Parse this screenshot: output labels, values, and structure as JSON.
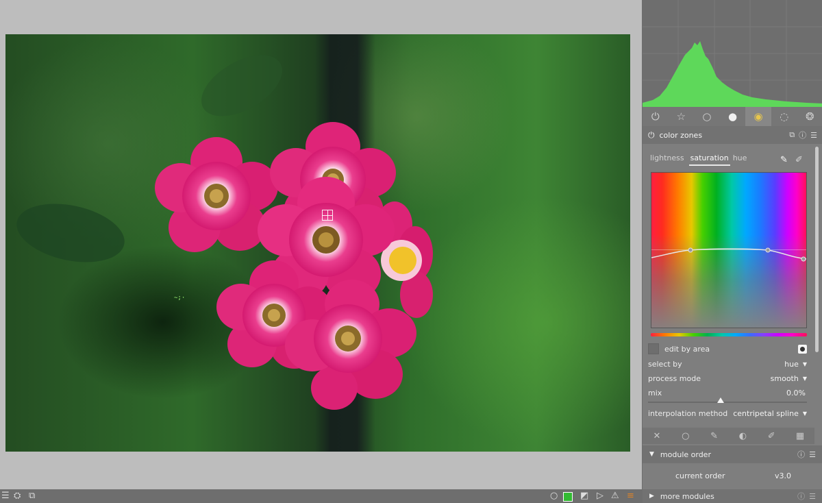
{
  "module_tabs": [
    {
      "icon": "power-icon",
      "glyph": "⏻"
    },
    {
      "icon": "star-icon",
      "glyph": "☆"
    },
    {
      "icon": "circle-icon",
      "glyph": "○"
    },
    {
      "icon": "tone-icon",
      "glyph": "●"
    },
    {
      "icon": "color-wheel-icon",
      "glyph": "◉"
    },
    {
      "icon": "correct-icon",
      "glyph": "◌"
    },
    {
      "icon": "effects-icon",
      "glyph": "❂"
    }
  ],
  "color_zones": {
    "title": "color zones",
    "tabs": [
      "lightness",
      "saturation",
      "hue"
    ],
    "active_tab": "saturation",
    "edit_by_area": "edit by area",
    "select_by_label": "select by",
    "select_by_value": "hue",
    "process_mode_label": "process mode",
    "process_mode_value": "smooth",
    "mix_label": "mix",
    "mix_value": "0.0%",
    "mix_level": 0.5,
    "interpolation_label": "interpolation method",
    "interpolation_value": "centripetal spline"
  },
  "module_order": {
    "title": "module order",
    "current_label": "current order",
    "current_value": "v3.0"
  },
  "more_modules": {
    "title": "more modules"
  },
  "colors": {
    "histogram_fill": "#5ed85a",
    "panel_bg": "#7e7e7e",
    "center_bg": "#bdbdbd",
    "flower_pink": "#e0237a"
  }
}
